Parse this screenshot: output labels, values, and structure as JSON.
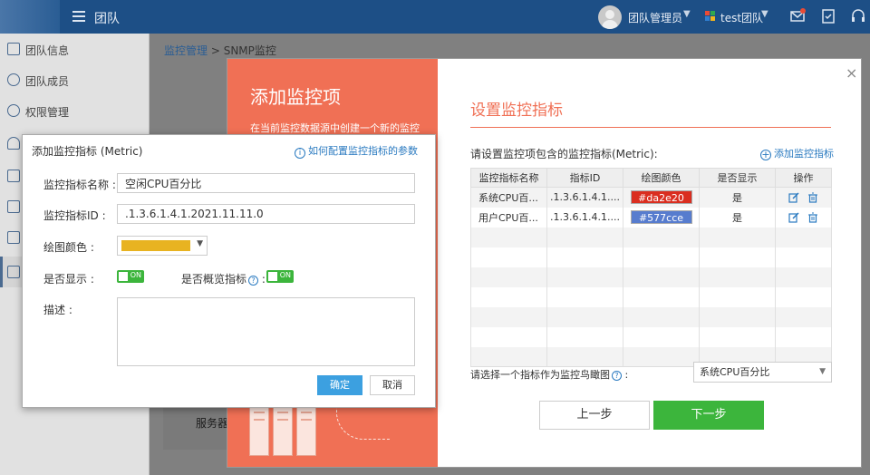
{
  "topbar": {
    "title": "团队",
    "user": "团队管理员",
    "team": "test团队",
    "icons": [
      "menu-icon",
      "message-icon",
      "task-icon",
      "headset-icon"
    ]
  },
  "sidebar": {
    "items": [
      {
        "label": "团队信息",
        "icon": "team-info-icon"
      },
      {
        "label": "团队成员",
        "icon": "team-members-icon"
      },
      {
        "label": "权限管理",
        "icon": "permission-icon"
      },
      {
        "icon": "cloud-icon"
      },
      {
        "icon": "book-icon"
      },
      {
        "icon": "contact-icon"
      },
      {
        "icon": "image-icon"
      },
      {
        "icon": "monitor-icon"
      }
    ]
  },
  "breadcrumb": {
    "parent": "监控管理",
    "separator": " > ",
    "current": "SNMP监控"
  },
  "background": {
    "server_label": "服务器"
  },
  "wizard": {
    "title": "添加监控项",
    "description": "在当前监控数据源中创建一个新的监控",
    "right_title": "设置监控指标",
    "metric_label": "请设置监控项包含的监控指标(Metric):",
    "add_metric": "添加监控指标",
    "table": {
      "headers": [
        "监控指标名称",
        "指标ID",
        "绘图颜色",
        "是否显示",
        "操作"
      ],
      "rows": [
        {
          "name": "系统CPU百...",
          "id": ".1.3.6.1.4.1....",
          "color": "#da2e20",
          "show": "是"
        },
        {
          "name": "用户CPU百...",
          "id": ".1.3.6.1.4.1....",
          "color": "#577cce",
          "show": "是"
        }
      ]
    },
    "select_label": "请选择一个指标作为监控鸟瞰图",
    "select_colon": ":",
    "select_value": "系统CPU百分比",
    "prev": "上一步",
    "next": "下一步",
    "accent": "#f07055",
    "close": "×"
  },
  "dialog": {
    "title": "添加监控指标 (Metric)",
    "help_link": "如何配置监控指标的参数",
    "name_label": "监控指标名称 :",
    "name_value": "空闲CPU百分比",
    "id_label": "监控指标ID :",
    "id_value": ".1.3.6.1.4.1.2021.11.11.0",
    "color_label": "绘图颜色 :",
    "color_value": "#e8b321",
    "show_label": "是否显示 :",
    "show_toggle": "ON",
    "overview_label": "是否概览指标",
    "overview_colon": ":",
    "overview_toggle": "ON",
    "desc_label": "描述 :",
    "ok": "确定",
    "cancel": "取消"
  }
}
